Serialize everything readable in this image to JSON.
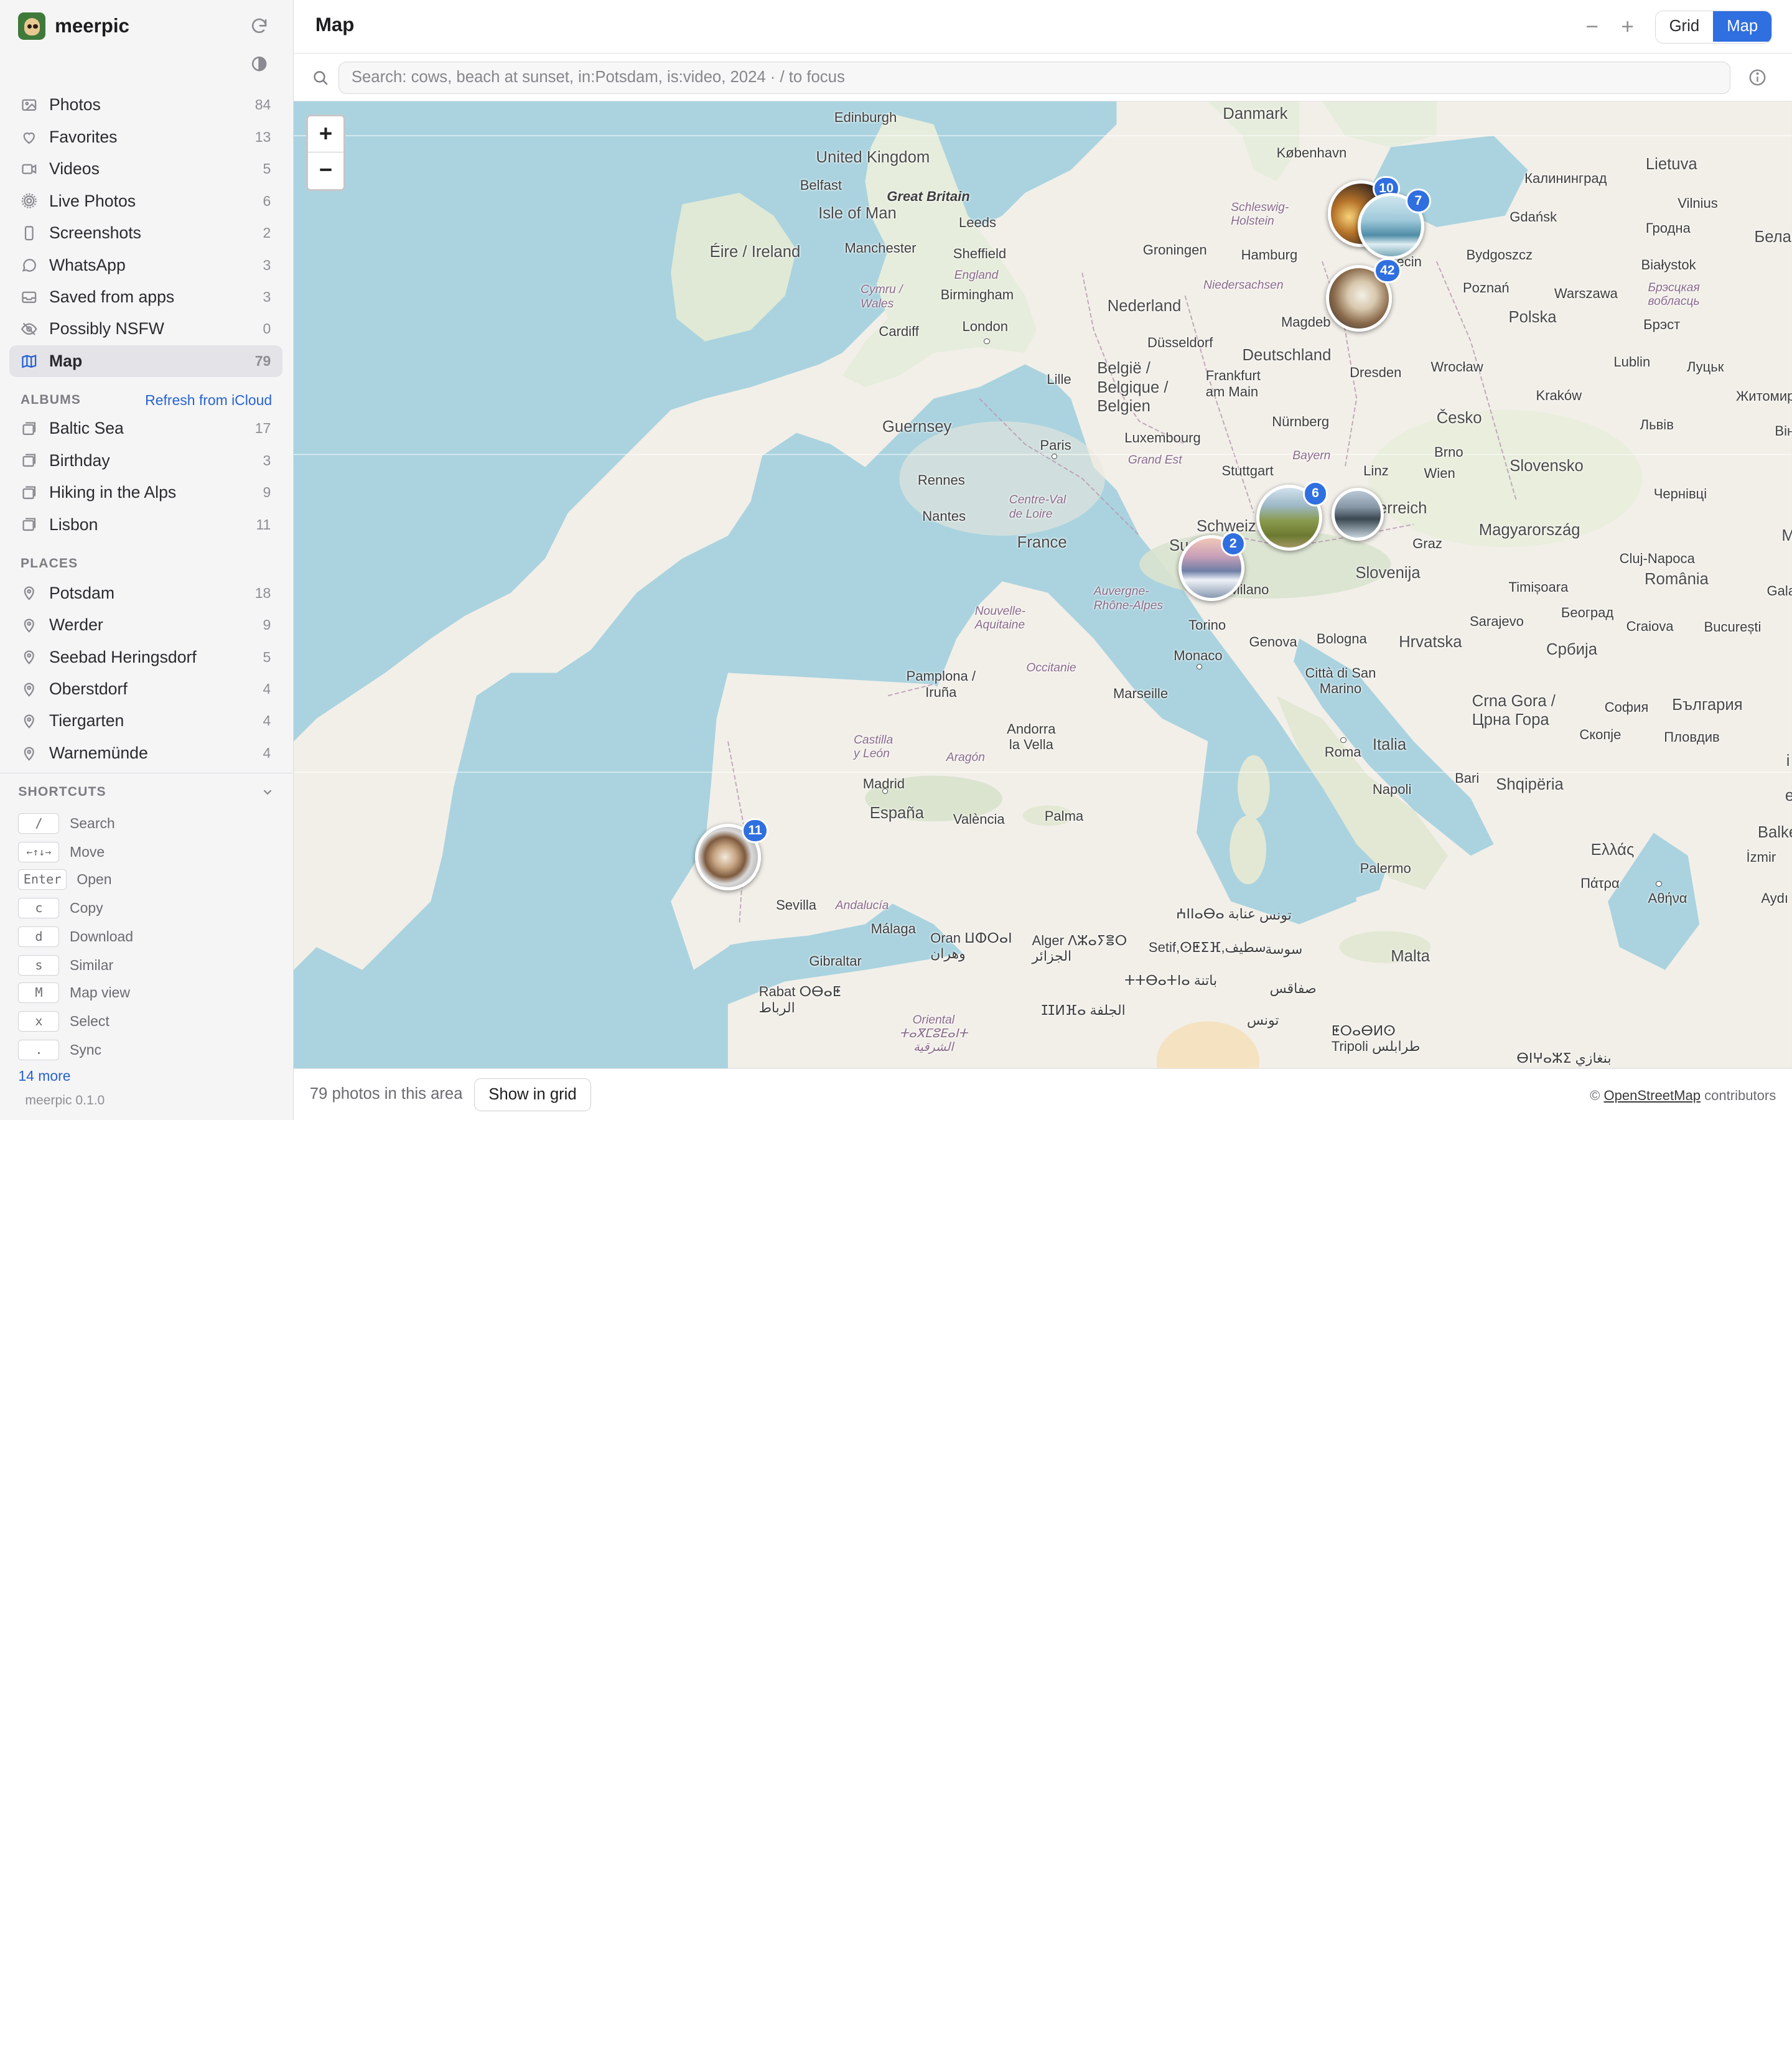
{
  "app": {
    "name": "meerpic",
    "version": "meerpic 0.1.0"
  },
  "sidebar": {
    "library": [
      {
        "label": "Photos",
        "count": "84",
        "icon": "photo-icon"
      },
      {
        "label": "Favorites",
        "count": "13",
        "icon": "heart-icon"
      },
      {
        "label": "Videos",
        "count": "5",
        "icon": "video-icon"
      },
      {
        "label": "Live Photos",
        "count": "6",
        "icon": "live-photo-icon"
      },
      {
        "label": "Screenshots",
        "count": "2",
        "icon": "phone-icon"
      },
      {
        "label": "WhatsApp",
        "count": "3",
        "icon": "chat-bubble-icon"
      },
      {
        "label": "Saved from apps",
        "count": "3",
        "icon": "inbox-icon"
      },
      {
        "label": "Possibly NSFW",
        "count": "0",
        "icon": "eye-off-icon"
      },
      {
        "label": "Map",
        "count": "79",
        "icon": "map-icon",
        "active": true
      }
    ],
    "albums_title": "ALBUMS",
    "albums_refresh": "Refresh from iCloud",
    "albums": [
      {
        "label": "Baltic Sea",
        "count": "17"
      },
      {
        "label": "Birthday",
        "count": "3"
      },
      {
        "label": "Hiking in the Alps",
        "count": "9"
      },
      {
        "label": "Lisbon",
        "count": "11"
      }
    ],
    "places_title": "PLACES",
    "places": [
      {
        "label": "Potsdam",
        "count": "18"
      },
      {
        "label": "Werder",
        "count": "9"
      },
      {
        "label": "Seebad Heringsdorf",
        "count": "5"
      },
      {
        "label": "Oberstdorf",
        "count": "4"
      },
      {
        "label": "Tiergarten",
        "count": "4"
      },
      {
        "label": "Warnemünde",
        "count": "4"
      }
    ],
    "shortcuts_title": "SHORTCUTS",
    "shortcuts": [
      {
        "key": "/",
        "label": "Search"
      },
      {
        "key": "←↑↓→",
        "label": "Move"
      },
      {
        "key": "Enter",
        "label": "Open"
      },
      {
        "key": "c",
        "label": "Copy"
      },
      {
        "key": "d",
        "label": "Download"
      },
      {
        "key": "s",
        "label": "Similar"
      },
      {
        "key": "M",
        "label": "Map view"
      },
      {
        "key": "x",
        "label": "Select"
      },
      {
        "key": ".",
        "label": "Sync"
      }
    ],
    "more": "14 more"
  },
  "header": {
    "title": "Map",
    "view_grid": "Grid",
    "view_map": "Map",
    "active_view": "Map"
  },
  "search": {
    "placeholder": "Search: cows, beach at sunset, in:Potsdam, is:video, 2024 · / to focus",
    "value": ""
  },
  "map": {
    "zoom_in": "+",
    "zoom_out": "−",
    "clusters": [
      {
        "id": "baltic-a",
        "count": "10"
      },
      {
        "id": "baltic-b",
        "count": "7"
      },
      {
        "id": "berlin",
        "count": "42"
      },
      {
        "id": "alps-east",
        "count": "6"
      },
      {
        "id": "alps-west",
        "count": ""
      },
      {
        "id": "switzerland",
        "count": "2"
      },
      {
        "id": "lisbon",
        "count": "11"
      }
    ],
    "labels": {
      "danmark": "Danmark",
      "kobenhavn": "København",
      "edinburgh": "Edinburgh",
      "uk": "United Kingdom",
      "belfast": "Belfast",
      "gb": "Great Britain",
      "isle_of_man": "Isle of Man",
      "eire": "Éire / Ireland",
      "leeds": "Leeds",
      "manchester": "Manchester",
      "sheffield": "Sheffield",
      "england": "England",
      "cymru": "Cymru /\nWales",
      "birmingham": "Birmingham",
      "cardiff": "Cardiff",
      "london": "London",
      "schleswig": "Schleswig-\nHolstein",
      "hamburg": "Hamburg",
      "groningen": "Groningen",
      "niedersachsen": "Niedersachsen",
      "nederland": "Nederland",
      "dusseldorf": "Düsseldorf",
      "deutschland": "Deutschland",
      "magdeburg": "Magdeb",
      "szczecin": "ecin",
      "belgie": "België /\nBelgique /\nBelgien",
      "lille": "Lille",
      "frankfurt": "Frankfurt\nam Main",
      "dresden": "Dresden",
      "nurnberg": "Nürnberg",
      "luxembourg": "Luxembourg",
      "paris": "Paris",
      "grand_est": "Grand Est",
      "bayern": "Bayern",
      "guernsey": "Guernsey",
      "stuttgart": "Stuttgart",
      "rennes": "Rennes",
      "centre": "Centre-Val\nde Loire",
      "nantes": "Nantes",
      "france": "France",
      "schweiz": "Schweiz",
      "suisse": "Su",
      "linz": "Linz",
      "wien": "Wien",
      "osterreich": "sterreich",
      "graz": "Graz",
      "slovenija": "Slovenija",
      "milano": "Milano",
      "torino": "Torino",
      "auvergne": "Auvergne-\nRhône-Alpes",
      "nouvelle": "Nouvelle-\nAquitaine",
      "occitanie": "Occitanie",
      "monaco": "Monaco",
      "genova": "Genova",
      "bologna": "Bologna",
      "sanmarino": "Città di San\nMarino",
      "marseille": "Marseille",
      "hrvatska": "Hrvatska",
      "pamplona": "Pamplona /\nIruña",
      "andorra": "Andorra\nla Vella",
      "castilla": "Castilla\ny León",
      "aragon": "Aragón",
      "madrid": "Madrid",
      "espana": "España",
      "valencia": "València",
      "palma": "Palma",
      "italia": "Italia",
      "roma": "Roma",
      "napoli": "Napoli",
      "bari": "Bari",
      "palermo": "Palermo",
      "malta": "Malta",
      "sevilla": "Sevilla",
      "andalucia": "Andalucía",
      "malaga": "Málaga",
      "gibraltar": "Gibraltar",
      "rabat": "Rabat ⵔⴱⴰⵟ\nالرباط",
      "oran": "Oran ⵡⵀⵔⴰⵏ\nوهران",
      "alger": "Alger ⴷⵣⴰⵢⴻⵔ\nالجزائر",
      "setif": "Setif,ⵙⵟⵉⴼ,سطيف",
      "tunis": "تونس",
      "annaba": "ⵄⵏⵏⴰⴱⴰ عنابة",
      "sousse": "سوسة",
      "batna": "ⵜⵜⴱⴰⵜⵏⴰ باتنة",
      "sfax": "صفاقس",
      "djelfa": "ⵊⵊⵍⴼⴰ الجلفة",
      "tunis2": "تونس",
      "tripoli": "ⵟⵔⴰⴱⵍⵙ\nTripoli طرابلس",
      "oriental": "Oriental\nⵜⴰⴳⵎⵓⴹⴰⵏⵜ\nالشرقية",
      "benghazi": "ⴱⵏⵖⴰⵣⵉ بنغازي",
      "kaliningrad": "Калининград",
      "lietuva": "Lietuva",
      "vilnius": "Vilnius",
      "gdansk": "Gdańsk",
      "hrodna": "Гродна",
      "bydgoszcz": "Bydgoszcz",
      "bialystok": "Białystok",
      "bela": "Белар",
      "poznan": "Poznań",
      "warszawa": "Warszawa",
      "brest_reg": "Брэсцкая\nвобласць",
      "polska": "Polska",
      "brest": "Брэст",
      "wroclaw": "Wrocław",
      "lublin": "Lublin",
      "lutsk": "Луцьк",
      "krakow": "Kraków",
      "zhytomyr": "Житомир",
      "cesko": "Česko",
      "lviv": "Львів",
      "brno": "Brno",
      "vin": "Він",
      "slovensko": "Slovensko",
      "chernivtsi": "Чернівці",
      "magyarorszag": "Magyarország",
      "cluj": "Cluj-Napoca",
      "romania": "România",
      "timisoara": "Timișoara",
      "gal": "Gala",
      "beograd": "Београд",
      "sarajevo": "Sarajevo",
      "srbija": "Србија",
      "craiova": "Craiova",
      "bucuresti": "București",
      "crnagora": "Crna Gora /\nЦрна Гора",
      "sofia": "София",
      "bulgaria": "България",
      "skopje": "Скопје",
      "plovdiv": "Пловдив",
      "shqiperia": "Shqipëria",
      "ellas": "Ελλάς",
      "patra": "Πάτρα",
      "athina": "Αθήνα",
      "balk": "Balke",
      "izm": "İzmir",
      "ayd": "Aydı",
      "m_edge": "M",
      "i_edge": "i",
      "e_edge": "e"
    }
  },
  "footer": {
    "count_text": "79 photos in this area",
    "show_grid": "Show in grid",
    "attribution_prefix": "©",
    "attribution_link": "OpenStreetMap",
    "attribution_suffix": "contributors"
  }
}
